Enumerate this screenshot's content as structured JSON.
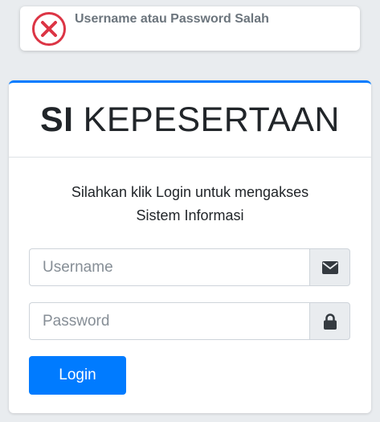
{
  "alert": {
    "message": "Username atau Password Salah",
    "icon": "error-x-circle-icon",
    "color": "#dc3545"
  },
  "header": {
    "title_bold": "SI",
    "title_rest": "KEPESERTAAN"
  },
  "login": {
    "message_line1": "Silahkan klik Login untuk mengakses",
    "message_line2": "Sistem Informasi",
    "username_placeholder": "Username",
    "username_icon": "envelope-icon",
    "password_placeholder": "Password",
    "password_icon": "lock-icon",
    "button_label": "Login"
  },
  "colors": {
    "accent": "#007bff",
    "background": "#e9ecef"
  }
}
